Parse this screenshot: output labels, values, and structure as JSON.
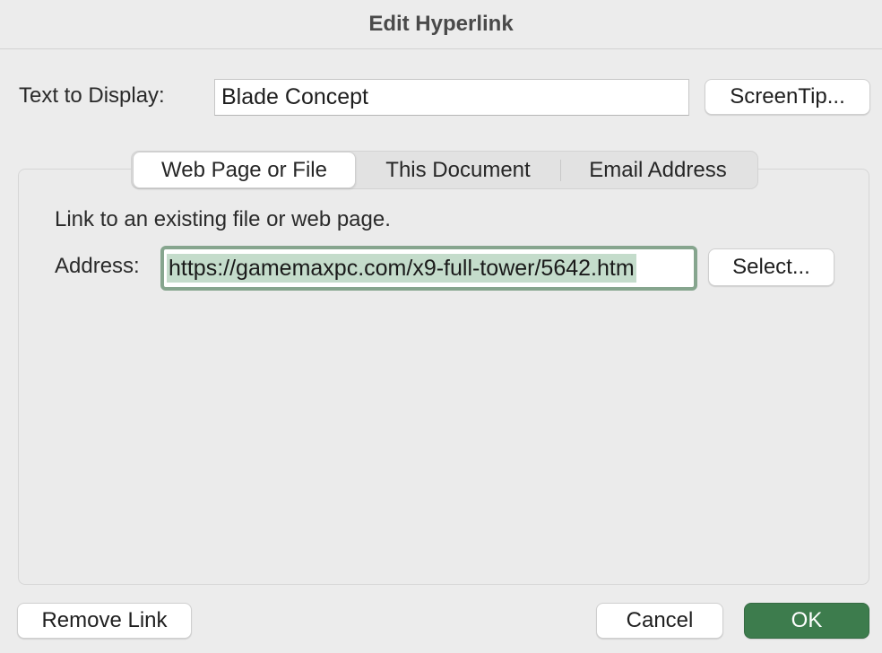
{
  "dialog": {
    "title": "Edit Hyperlink"
  },
  "display": {
    "label": "Text to Display:",
    "value": "Blade Concept",
    "screentip_label": "ScreenTip..."
  },
  "tabs": [
    {
      "label": "Web Page or File",
      "active": true
    },
    {
      "label": "This Document",
      "active": false
    },
    {
      "label": "Email Address",
      "active": false
    }
  ],
  "web_page": {
    "description": "Link to an existing file or web page.",
    "address_label": "Address:",
    "address_value": "https://gamemaxpc.com/x9-full-tower/5642.htm",
    "select_label": "Select..."
  },
  "footer": {
    "remove_label": "Remove Link",
    "cancel_label": "Cancel",
    "ok_label": "OK"
  },
  "colors": {
    "accent": "#3d7c4d",
    "selection": "#c4dccb",
    "focus_ring": "#86a58e"
  }
}
